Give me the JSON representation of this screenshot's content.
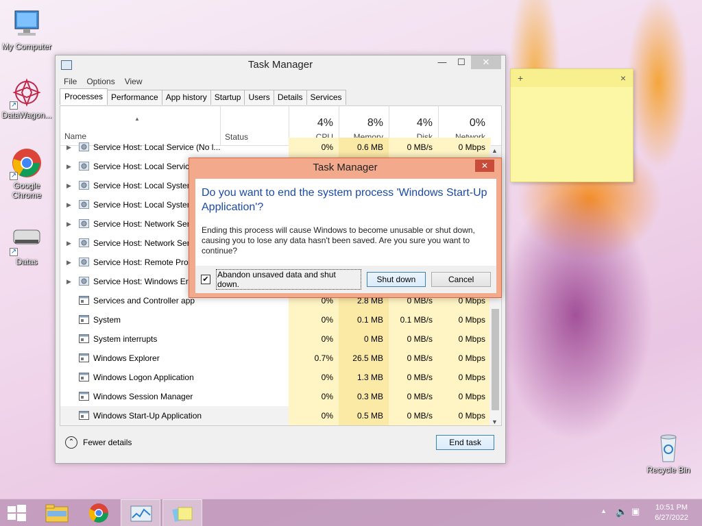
{
  "desktop": {
    "icons": [
      {
        "label": "My Computer"
      },
      {
        "label": "DataWagon..."
      },
      {
        "label": "Google Chrome"
      },
      {
        "label": "Datas"
      },
      {
        "label": "Recycle Bin"
      }
    ]
  },
  "task_manager": {
    "title": "Task Manager",
    "menu": [
      "File",
      "Options",
      "View"
    ],
    "tabs": [
      "Processes",
      "Performance",
      "App history",
      "Startup",
      "Users",
      "Details",
      "Services"
    ],
    "active_tab": "Processes",
    "columns": {
      "name": "Name",
      "status": "Status",
      "cpu": {
        "pct": "4%",
        "label": "CPU"
      },
      "memory": {
        "pct": "8%",
        "label": "Memory"
      },
      "disk": {
        "pct": "4%",
        "label": "Disk"
      },
      "network": {
        "pct": "0%",
        "label": "Network"
      }
    },
    "rows": [
      {
        "name": "Service Host: Local Service (No l...",
        "cpu": "0%",
        "mem": "0.6 MB",
        "disk": "0 MB/s",
        "net": "0 Mbps",
        "expand": true
      },
      {
        "name": "Service Host: Local Service",
        "cpu": "",
        "mem": "",
        "disk": "",
        "net": "",
        "expand": true
      },
      {
        "name": "Service Host: Local System",
        "cpu": "",
        "mem": "",
        "disk": "",
        "net": "",
        "expand": true
      },
      {
        "name": "Service Host: Local System",
        "cpu": "",
        "mem": "",
        "disk": "",
        "net": "",
        "expand": true
      },
      {
        "name": "Service Host: Network Serv",
        "cpu": "",
        "mem": "",
        "disk": "",
        "net": "",
        "expand": true
      },
      {
        "name": "Service Host: Network Serv",
        "cpu": "",
        "mem": "",
        "disk": "",
        "net": "",
        "expand": true
      },
      {
        "name": "Service Host: Remote Proc",
        "cpu": "",
        "mem": "",
        "disk": "",
        "net": "",
        "expand": true
      },
      {
        "name": "Service Host: Windows Err",
        "cpu": "",
        "mem": "",
        "disk": "",
        "net": "",
        "expand": true
      },
      {
        "name": "Services and Controller app",
        "cpu": "0%",
        "mem": "2.8 MB",
        "disk": "0 MB/s",
        "net": "0 Mbps",
        "expand": false
      },
      {
        "name": "System",
        "cpu": "0%",
        "mem": "0.1 MB",
        "disk": "0.1 MB/s",
        "net": "0 Mbps",
        "expand": false
      },
      {
        "name": "System interrupts",
        "cpu": "0%",
        "mem": "0 MB",
        "disk": "0 MB/s",
        "net": "0 Mbps",
        "expand": false
      },
      {
        "name": "Windows Explorer",
        "cpu": "0.7%",
        "mem": "26.5 MB",
        "disk": "0 MB/s",
        "net": "0 Mbps",
        "expand": false
      },
      {
        "name": "Windows Logon Application",
        "cpu": "0%",
        "mem": "1.3 MB",
        "disk": "0 MB/s",
        "net": "0 Mbps",
        "expand": false
      },
      {
        "name": "Windows Session Manager",
        "cpu": "0%",
        "mem": "0.3 MB",
        "disk": "0 MB/s",
        "net": "0 Mbps",
        "expand": false
      },
      {
        "name": "Windows Start-Up Application",
        "cpu": "0%",
        "mem": "0.5 MB",
        "disk": "0 MB/s",
        "net": "0 Mbps",
        "expand": false
      }
    ],
    "fewer_details": "Fewer details",
    "end_task": "End task"
  },
  "dialog": {
    "title": "Task Manager",
    "question": "Do you want to end the system process 'Windows Start-Up Application'?",
    "description": "Ending this process will cause Windows to become unusable or shut down, causing you to lose any data hasn't been saved. Are you sure you want to continue?",
    "checkbox_label": "Abandon unsaved data and shut down.",
    "checkbox_checked": true,
    "shutdown_label": "Shut down",
    "cancel_label": "Cancel"
  },
  "taskbar": {
    "time": "10:51 PM",
    "date": "6/27/2022"
  },
  "colors": {
    "accent": "#1b4aa6",
    "dialog_frame": "#f2a98c",
    "heat_light": "#fff4c4",
    "heat_mid": "#fbe9a6"
  }
}
